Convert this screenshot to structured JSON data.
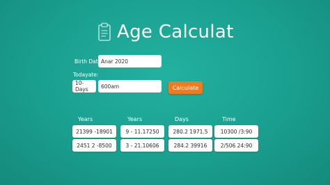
{
  "app": {
    "title": "Age Calculat",
    "title_icon": "clipboard-icon"
  },
  "form": {
    "birth_date_label": "Birth Date:",
    "birth_date_value": "Anar 2020",
    "todayate_label": "Todayate:",
    "days_value": "10- Days",
    "time_value": "600am",
    "calculate_label": "Calculate"
  },
  "results": {
    "headers": [
      "Years",
      "Years",
      "Days",
      "Time"
    ],
    "rows": [
      [
        "21399 -18901",
        "9 - 11.17250",
        "280.2 1971.5",
        "10300 /3:90"
      ],
      [
        "2451 2 -8500",
        "3 - 21.10606",
        "284.2 39916",
        "2/506 24:90"
      ]
    ]
  },
  "colors": {
    "background": "#1a9f8f",
    "accent": "#f07b1e"
  }
}
